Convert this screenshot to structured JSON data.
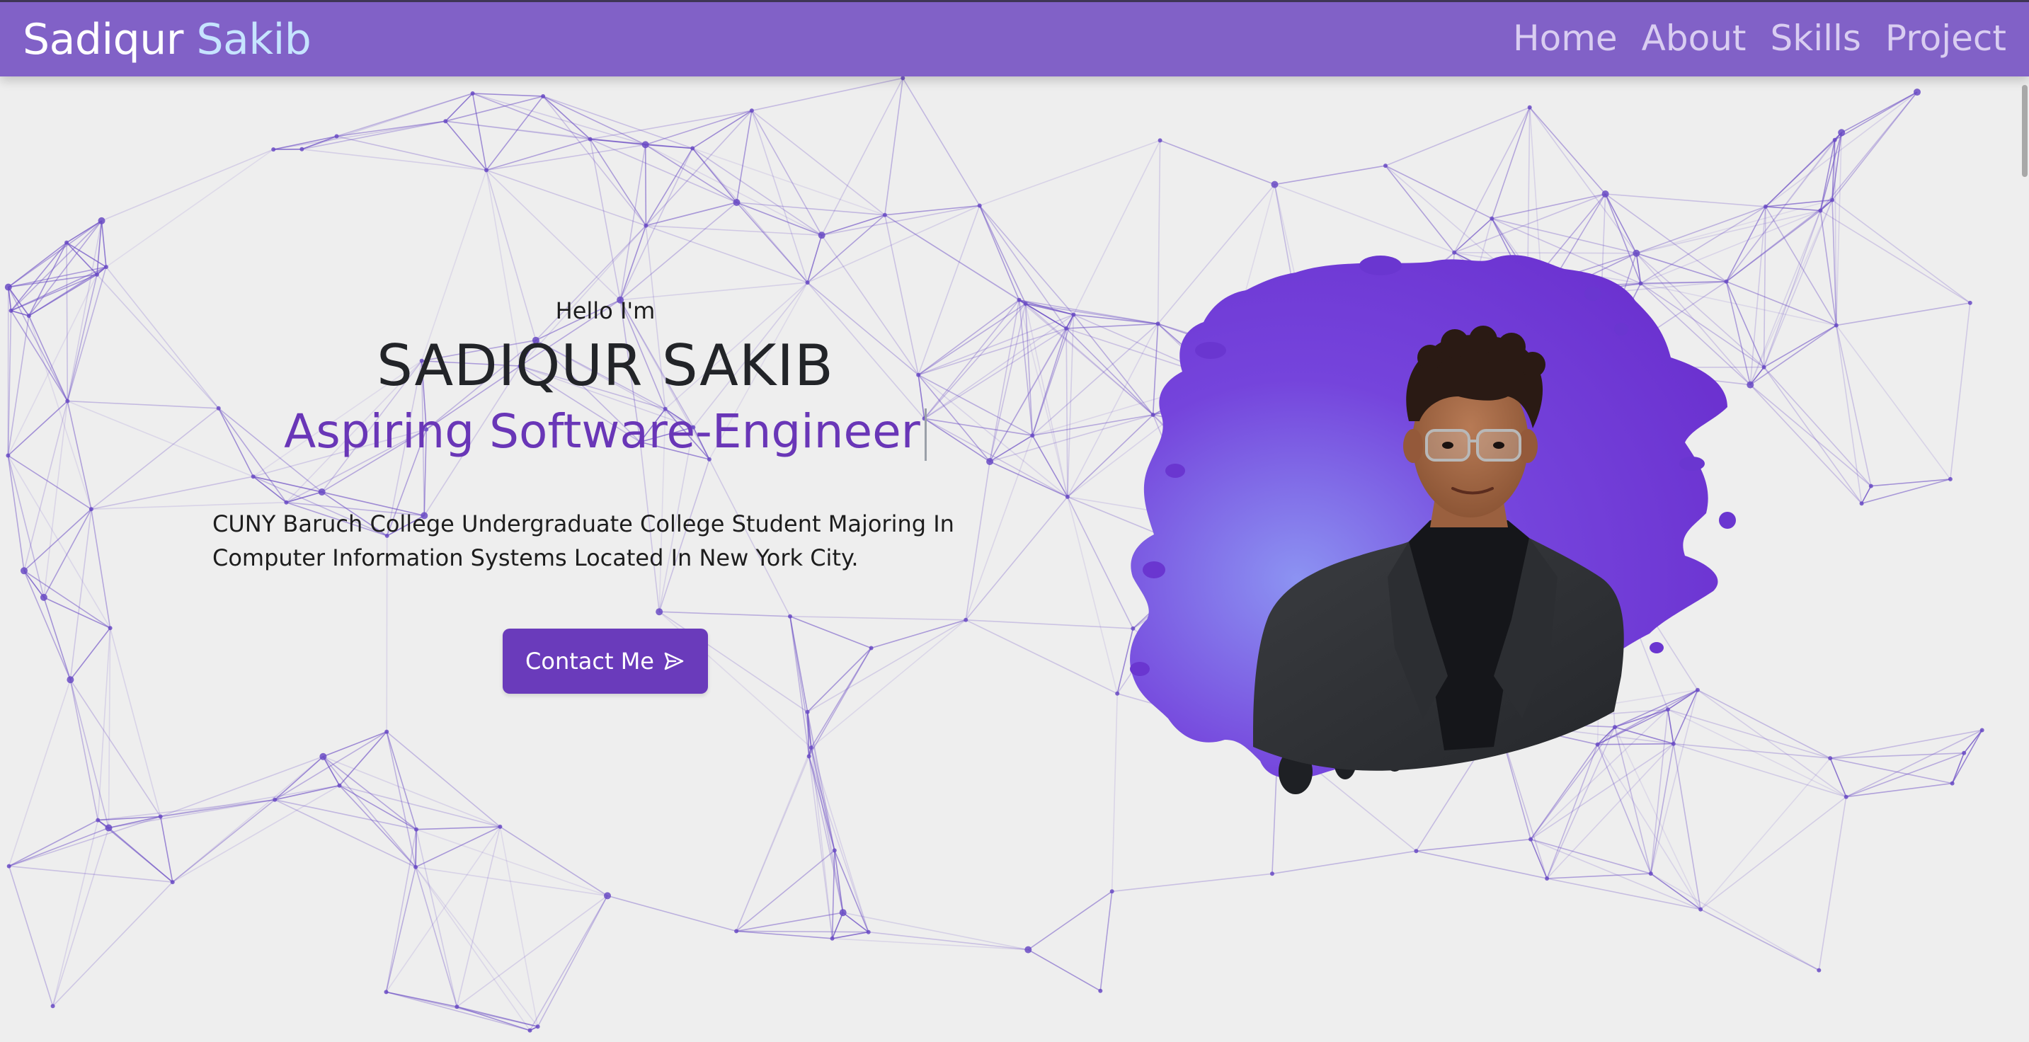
{
  "navbar": {
    "brand_first": "Sadiqur",
    "brand_second": "Sakib",
    "links": [
      {
        "label": "Home"
      },
      {
        "label": "About"
      },
      {
        "label": "Skills"
      },
      {
        "label": "Project"
      }
    ]
  },
  "hero": {
    "greeting": "Hello I'm",
    "name": "SADIQUR SAKIB",
    "role": "Aspiring Software-Engineer",
    "description": "CUNY Baruch College Undergraduate College Student Majoring In Computer Information Systems Located In New York City.",
    "contact_button": "Contact Me",
    "contact_icon": "send-icon"
  },
  "portrait": {
    "image": "profile-photo"
  },
  "colors": {
    "navbar": "#7a58c4",
    "brand_accent": "#c6e4ff",
    "nav_link": "#d9cdf1",
    "role_text": "#6936b7",
    "button": "#6a3bbb",
    "network_lines": "#6a4bc4",
    "background": "#eeeeee",
    "splash_dark": "#6a2fd0",
    "splash_light": "#8a8cf0"
  }
}
